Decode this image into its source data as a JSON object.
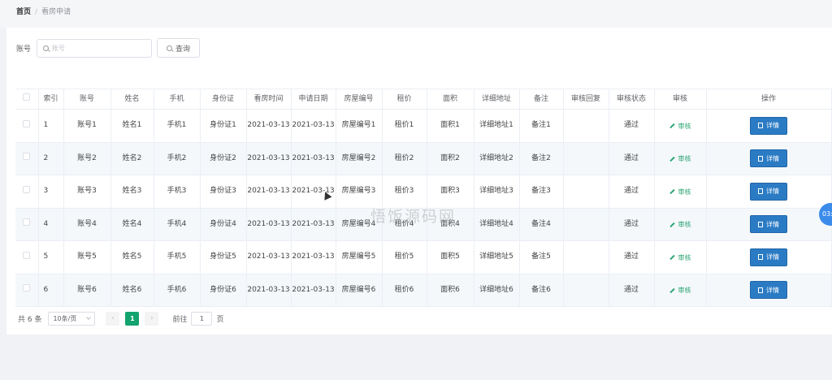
{
  "breadcrumb": {
    "home": "首页",
    "separator": "/",
    "current": "看房申请"
  },
  "search": {
    "label": "账号",
    "placeholder": "账号",
    "button_label": "查询"
  },
  "table": {
    "headers": [
      "索引",
      "账号",
      "姓名",
      "手机",
      "身份证",
      "看房时间",
      "申请日期",
      "房屋编号",
      "租价",
      "面积",
      "详细地址",
      "备注",
      "审核回复",
      "审核状态",
      "审核",
      "操作"
    ],
    "rows": [
      {
        "index": "1",
        "account": "账号1",
        "name": "姓名1",
        "phone": "手机1",
        "id_card": "身份证1",
        "view_time": "2021-03-13",
        "apply_date": "2021-03-13",
        "house_no": "房屋编号1",
        "rent": "租价1",
        "area": "面积1",
        "address": "详细地址1",
        "note": "备注1",
        "reply": "",
        "status": "通过",
        "audit": "审核",
        "action": "详情"
      },
      {
        "index": "2",
        "account": "账号2",
        "name": "姓名2",
        "phone": "手机2",
        "id_card": "身份证2",
        "view_time": "2021-03-13",
        "apply_date": "2021-03-13",
        "house_no": "房屋编号2",
        "rent": "租价2",
        "area": "面积2",
        "address": "详细地址2",
        "note": "备注2",
        "reply": "",
        "status": "通过",
        "audit": "审核",
        "action": "详情"
      },
      {
        "index": "3",
        "account": "账号3",
        "name": "姓名3",
        "phone": "手机3",
        "id_card": "身份证3",
        "view_time": "2021-03-13",
        "apply_date": "2021-03-13",
        "house_no": "房屋编号3",
        "rent": "租价3",
        "area": "面积3",
        "address": "详细地址3",
        "note": "备注3",
        "reply": "",
        "status": "通过",
        "audit": "审核",
        "action": "详情"
      },
      {
        "index": "4",
        "account": "账号4",
        "name": "姓名4",
        "phone": "手机4",
        "id_card": "身份证4",
        "view_time": "2021-03-13",
        "apply_date": "2021-03-13",
        "house_no": "房屋编号4",
        "rent": "租价4",
        "area": "面积4",
        "address": "详细地址4",
        "note": "备注4",
        "reply": "",
        "status": "通过",
        "audit": "审核",
        "action": "详情"
      },
      {
        "index": "5",
        "account": "账号5",
        "name": "姓名5",
        "phone": "手机5",
        "id_card": "身份证5",
        "view_time": "2021-03-13",
        "apply_date": "2021-03-13",
        "house_no": "房屋编号5",
        "rent": "租价5",
        "area": "面积5",
        "address": "详细地址5",
        "note": "备注5",
        "reply": "",
        "status": "通过",
        "audit": "审核",
        "action": "详情"
      },
      {
        "index": "6",
        "account": "账号6",
        "name": "姓名6",
        "phone": "手机6",
        "id_card": "身份证6",
        "view_time": "2021-03-13",
        "apply_date": "2021-03-13",
        "house_no": "房屋编号6",
        "rent": "租价6",
        "area": "面积6",
        "address": "详细地址6",
        "note": "备注6",
        "reply": "",
        "status": "通过",
        "audit": "审核",
        "action": "详情"
      }
    ]
  },
  "pagination": {
    "total_label": "共 6 条",
    "page_size_label": "10条/页",
    "prev_label": "‹",
    "current_page": "1",
    "next_label": "›",
    "goto_label": "前往",
    "goto_value": "1",
    "page_suffix": "页"
  },
  "watermark": "悟饭源码网",
  "float_badge": "03:",
  "colors": {
    "primary_button": "#2b7bc4",
    "active_page": "#13a36f",
    "audit_link": "#2ba471",
    "float_badge": "#3b8beb"
  }
}
